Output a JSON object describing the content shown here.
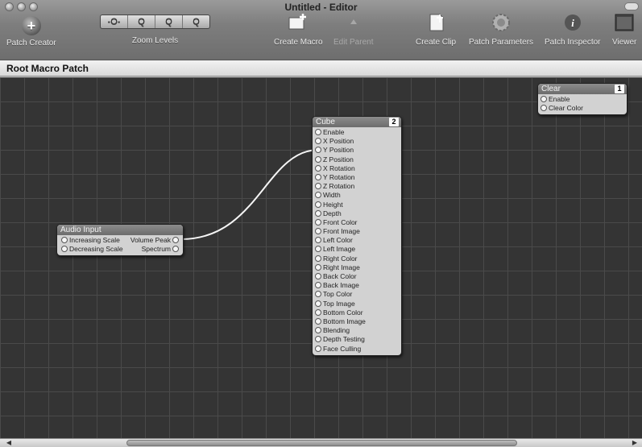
{
  "window": {
    "title": "Untitled - Editor"
  },
  "toolbar": {
    "patch_creator": "Patch Creator",
    "zoom_levels": "Zoom Levels",
    "zoom_buttons": [
      "-O-",
      "Q",
      "Q",
      "Q"
    ],
    "create_macro": "Create Macro",
    "edit_parent": "Edit Parent",
    "create_clip": "Create Clip",
    "patch_parameters": "Patch Parameters",
    "patch_inspector": "Patch Inspector",
    "viewer": "Viewer"
  },
  "breadcrumb": {
    "label": "Root Macro Patch"
  },
  "patches": {
    "clear": {
      "title": "Clear",
      "badge": "1",
      "inputs": [
        "Enable",
        "Clear Color"
      ]
    },
    "cube": {
      "title": "Cube",
      "badge": "2",
      "inputs": [
        "Enable",
        "X Position",
        "Y Position",
        "Z Position",
        "X Rotation",
        "Y Rotation",
        "Z Rotation",
        "Width",
        "Height",
        "Depth",
        "Front Color",
        "Front Image",
        "Left Color",
        "Left Image",
        "Right Color",
        "Right Image",
        "Back Color",
        "Back Image",
        "Top Color",
        "Top Image",
        "Bottom Color",
        "Bottom Image",
        "Blending",
        "Depth Testing",
        "Face Culling"
      ]
    },
    "audio_input": {
      "title": "Audio Input",
      "inputs": [
        "Increasing Scale",
        "Decreasing Scale"
      ],
      "outputs": [
        "Volume Peak",
        "Spectrum"
      ]
    }
  },
  "icons": {
    "patch_creator": "plus-icon",
    "create_macro": "create-macro-icon",
    "edit_parent": "up-arrow-icon",
    "create_clip": "clip-icon",
    "patch_parameters": "gear-icon",
    "patch_inspector": "info-icon",
    "viewer": "viewer-icon"
  }
}
